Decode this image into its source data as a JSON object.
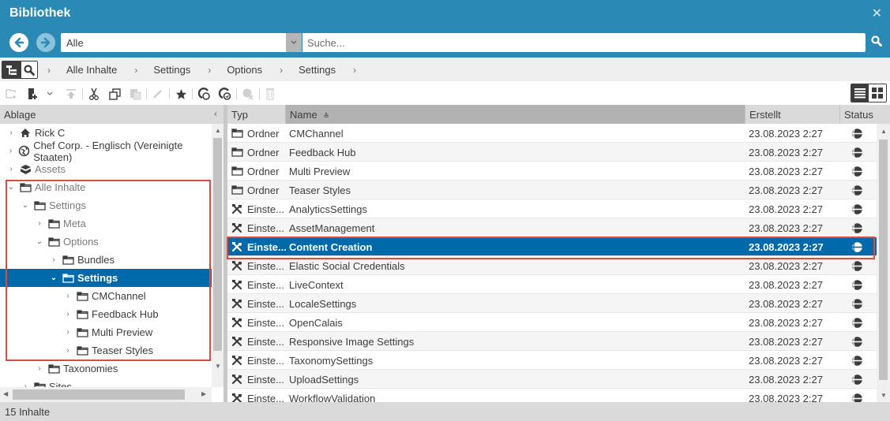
{
  "window": {
    "title": "Bibliothek",
    "close_icon": "close-icon"
  },
  "search": {
    "scope_value": "Alle",
    "placeholder": "Suche...",
    "back_icon": "arrow-left-icon",
    "forward_icon": "arrow-right-icon",
    "search_icon": "search-icon"
  },
  "breadcrumb": [
    "Alle Inhalte",
    "Settings",
    "Options",
    "Settings"
  ],
  "toolbar": {
    "buttons": [
      "new-folder",
      "new-content",
      "new-content-menu",
      "move-up",
      "cut",
      "copy",
      "paste",
      "edit",
      "bookmark",
      "check-in",
      "check-out",
      "withdraw",
      "delete"
    ]
  },
  "left_panel": {
    "header": "Ablage",
    "collapse_icon": "chevron-left-icon",
    "tree": [
      {
        "label": "Rick C",
        "icon": "home-icon",
        "level": 0,
        "expanded": false
      },
      {
        "label": "Chef Corp. - Englisch (Vereinigte Staaten)",
        "icon": "site-icon",
        "level": 0,
        "expanded": false
      },
      {
        "label": "Assets",
        "icon": "assets-icon",
        "level": 0,
        "expanded": false
      },
      {
        "label": "Alle Inhalte",
        "icon": "folder-icon",
        "level": 0,
        "expanded": true
      },
      {
        "label": "Settings",
        "icon": "folder-icon",
        "level": 1,
        "expanded": true
      },
      {
        "label": "Meta",
        "icon": "folder-icon",
        "level": 2,
        "expanded": false
      },
      {
        "label": "Options",
        "icon": "folder-icon",
        "level": 2,
        "expanded": true
      },
      {
        "label": "Bundles",
        "icon": "folder-icon",
        "level": 3,
        "expanded": false
      },
      {
        "label": "Settings",
        "icon": "folder-icon",
        "level": 3,
        "expanded": true,
        "selected": true
      },
      {
        "label": "CMChannel",
        "icon": "folder-icon",
        "level": 4,
        "expanded": false
      },
      {
        "label": "Feedback Hub",
        "icon": "folder-icon",
        "level": 4,
        "expanded": false
      },
      {
        "label": "Multi Preview",
        "icon": "folder-icon",
        "level": 4,
        "expanded": false
      },
      {
        "label": "Teaser Styles",
        "icon": "folder-icon",
        "level": 4,
        "expanded": false
      },
      {
        "label": "Taxonomies",
        "icon": "folder-icon",
        "level": 2,
        "expanded": false
      },
      {
        "label": "Sites",
        "icon": "folder-icon",
        "level": 1,
        "expanded": false
      }
    ]
  },
  "grid": {
    "columns": [
      "Typ",
      "Name",
      "Erstellt",
      "Status"
    ],
    "sort_column": "Name",
    "rows": [
      {
        "type_icon": "folder-icon",
        "type": "Ordner",
        "name": "CMChannel",
        "created": "23.08.2023 2:27",
        "status": "published-icon"
      },
      {
        "type_icon": "folder-icon",
        "type": "Ordner",
        "name": "Feedback Hub",
        "created": "23.08.2023 2:27",
        "status": "published-icon"
      },
      {
        "type_icon": "folder-icon",
        "type": "Ordner",
        "name": "Multi Preview",
        "created": "23.08.2023 2:27",
        "status": "published-icon"
      },
      {
        "type_icon": "folder-icon",
        "type": "Ordner",
        "name": "Teaser Styles",
        "created": "23.08.2023 2:27",
        "status": "published-icon"
      },
      {
        "type_icon": "settings-icon",
        "type": "Einste...",
        "name": "AnalyticsSettings",
        "created": "23.08.2023 2:27",
        "status": "published-icon"
      },
      {
        "type_icon": "settings-icon",
        "type": "Einste...",
        "name": "AssetManagement",
        "created": "23.08.2023 2:27",
        "status": "published-icon"
      },
      {
        "type_icon": "settings-icon",
        "type": "Einste...",
        "name": "Content Creation",
        "created": "23.08.2023 2:27",
        "status": "published-icon",
        "selected": true
      },
      {
        "type_icon": "settings-icon",
        "type": "Einste...",
        "name": "Elastic Social Credentials",
        "created": "23.08.2023 2:27",
        "status": "published-icon"
      },
      {
        "type_icon": "settings-icon",
        "type": "Einste...",
        "name": "LiveContext",
        "created": "23.08.2023 2:27",
        "status": "published-icon"
      },
      {
        "type_icon": "settings-icon",
        "type": "Einste...",
        "name": "LocaleSettings",
        "created": "23.08.2023 2:27",
        "status": "published-icon"
      },
      {
        "type_icon": "settings-icon",
        "type": "Einste...",
        "name": "OpenCalais",
        "created": "23.08.2023 2:27",
        "status": "published-icon"
      },
      {
        "type_icon": "settings-icon",
        "type": "Einste...",
        "name": "Responsive Image Settings",
        "created": "23.08.2023 2:27",
        "status": "published-icon"
      },
      {
        "type_icon": "settings-icon",
        "type": "Einste...",
        "name": "TaxonomySettings",
        "created": "23.08.2023 2:27",
        "status": "published-icon"
      },
      {
        "type_icon": "settings-icon",
        "type": "Einste...",
        "name": "UploadSettings",
        "created": "23.08.2023 2:27",
        "status": "published-icon"
      },
      {
        "type_icon": "settings-icon",
        "type": "Einste...",
        "name": "WorkflowValidation",
        "created": "23.08.2023 2:27",
        "status": "published-icon"
      }
    ]
  },
  "status_bar": {
    "count_text": "15 Inhalte"
  },
  "colors": {
    "brand": "#2a8ab5",
    "selection": "#0069aa",
    "highlight_border": "#dc4a41"
  }
}
